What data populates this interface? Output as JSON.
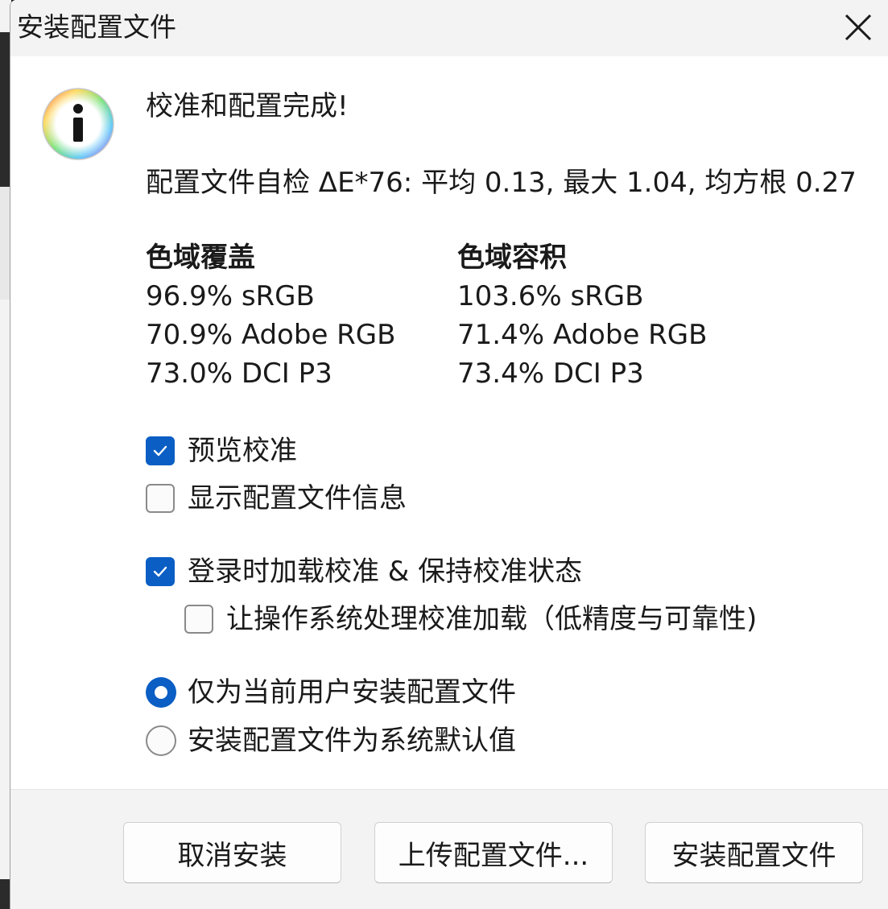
{
  "window": {
    "title": "安装配置文件"
  },
  "message": {
    "title": "校准和配置完成!",
    "stats": "配置文件自检 ΔE*76: 平均 0.13, 最大 1.04, 均方根 0.27"
  },
  "gamut_coverage": {
    "header": "色域覆盖",
    "rows": [
      "96.9% sRGB",
      "70.9% Adobe RGB",
      "73.0% DCI P3"
    ]
  },
  "gamut_volume": {
    "header": "色域容积",
    "rows": [
      "103.6% sRGB",
      "71.4% Adobe RGB",
      "73.4% DCI P3"
    ]
  },
  "options": {
    "preview_calibration": {
      "label": "预览校准",
      "checked": true
    },
    "show_profile_info": {
      "label": "显示配置文件信息",
      "checked": false
    },
    "load_on_login": {
      "label": "登录时加载校准 & 保持校准状态",
      "checked": true
    },
    "os_handle_loading": {
      "label": "让操作系统处理校准加载（低精度与可靠性)",
      "checked": false
    }
  },
  "install_scope": {
    "current_user": {
      "label": "仅为当前用户安装配置文件",
      "selected": true
    },
    "system_default": {
      "label": "安装配置文件为系统默认值",
      "selected": false
    }
  },
  "buttons": {
    "cancel": "取消安装",
    "upload": "上传配置文件...",
    "install": "安装配置文件"
  },
  "colors": {
    "accent": "#0a5ec4",
    "titlebar": "#f3f3f3",
    "background": "#ffffff"
  },
  "icons": {
    "info": "info-icon",
    "close": "close-icon",
    "check": "checkmark-icon"
  }
}
